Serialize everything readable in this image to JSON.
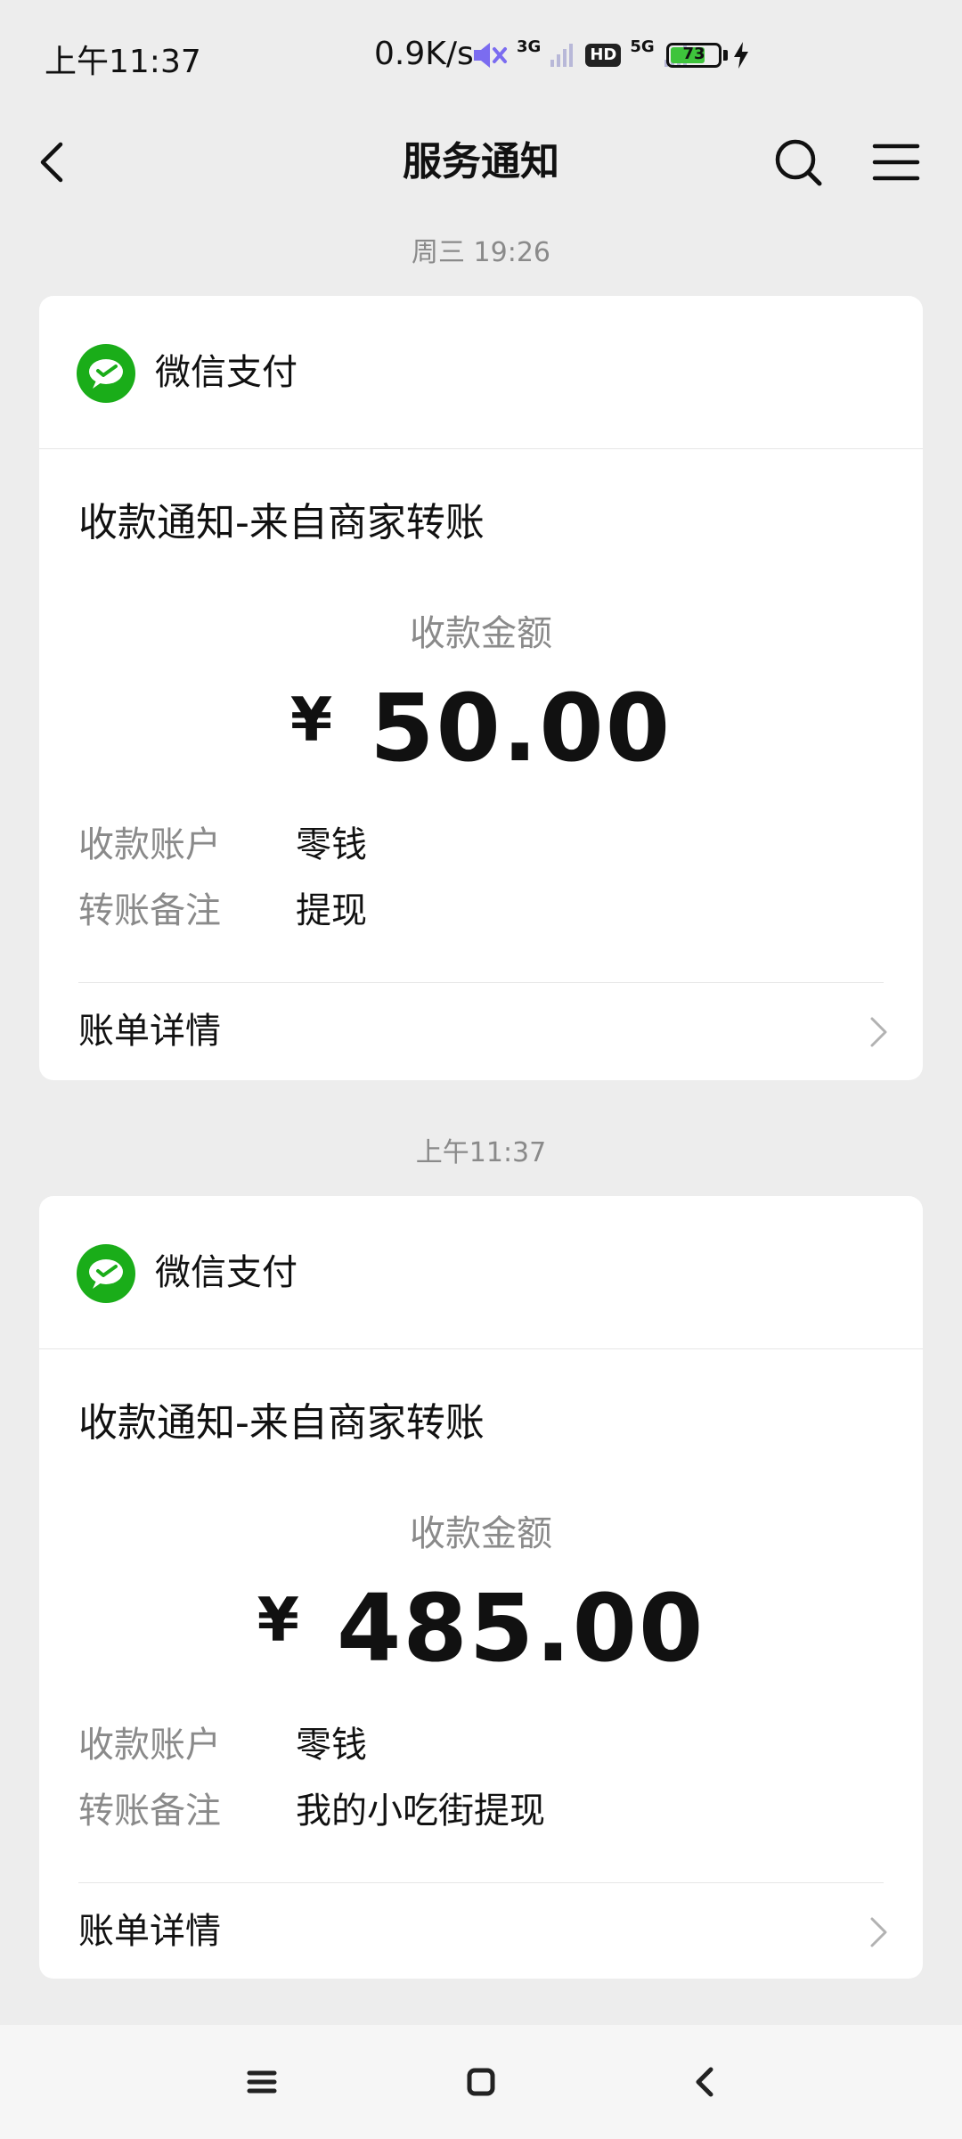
{
  "status_bar": {
    "time": "上午11:37",
    "net_speed": "0.9K/s",
    "signal_1": "3G",
    "hd": "HD",
    "signal_2": "5G",
    "battery": "73"
  },
  "nav": {
    "title": "服务通知",
    "back_icon": "chevron-left-icon",
    "search_icon": "search-icon",
    "menu_icon": "menu-icon"
  },
  "messages": [
    {
      "timestamp": "周三 19:26",
      "source": "微信支付",
      "title": "收款通知-来自商家转账",
      "amount_label": "收款金额",
      "currency": "¥",
      "amount": "50.00",
      "rows": [
        {
          "label": "收款账户",
          "value": "零钱"
        },
        {
          "label": "转账备注",
          "value": "提现"
        }
      ],
      "detail_link": "账单详情"
    },
    {
      "timestamp": "上午11:37",
      "source": "微信支付",
      "title": "收款通知-来自商家转账",
      "amount_label": "收款金额",
      "currency": "¥",
      "amount": "485.00",
      "rows": [
        {
          "label": "收款账户",
          "value": "零钱"
        },
        {
          "label": "转账备注",
          "value": "我的小吃街提现"
        }
      ],
      "detail_link": "账单详情"
    }
  ],
  "colors": {
    "background": "#ededed",
    "card": "#ffffff",
    "wechat_green": "#1aad19",
    "secondary_text": "#8a8a8a"
  }
}
